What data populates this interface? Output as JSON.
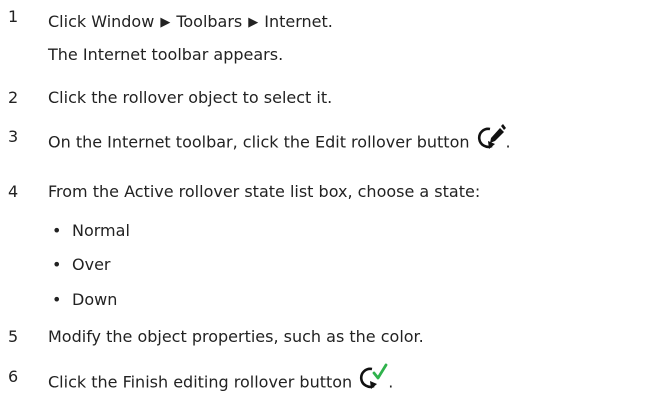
{
  "steps": [
    {
      "number": "1",
      "pre": "Click ",
      "menu": [
        "Window",
        "Toolbars",
        "Internet"
      ],
      "post": ".",
      "sub": {
        "pre": "The ",
        "bold": "Internet",
        "post": " toolbar appears."
      }
    },
    {
      "number": "2",
      "text": "Click the rollover object to select it."
    },
    {
      "number": "3",
      "pre": "On the ",
      "bold1": "Internet",
      "mid": " toolbar, click the ",
      "bold2": "Edit rollover",
      "post": " button",
      "end": "."
    },
    {
      "number": "4",
      "pre": "From the ",
      "bold": "Active rollover state",
      "post": " list box, choose a state:",
      "bullets": [
        "Normal",
        "Over",
        "Down"
      ],
      "bullet_char": "•"
    },
    {
      "number": "5",
      "text": "Modify the object properties, such as the color."
    },
    {
      "number": "6",
      "pre": "Click the ",
      "bold": "Finish editing rollover",
      "post": " button",
      "end": "."
    }
  ],
  "menu_separator": "▶",
  "icons": {
    "edit_rollover": "edit-rollover-icon",
    "finish_editing_rollover": "finish-editing-rollover-icon"
  },
  "colors": {
    "text": "#222222",
    "checkmark": "#2fb24c",
    "icon": "#111111"
  }
}
